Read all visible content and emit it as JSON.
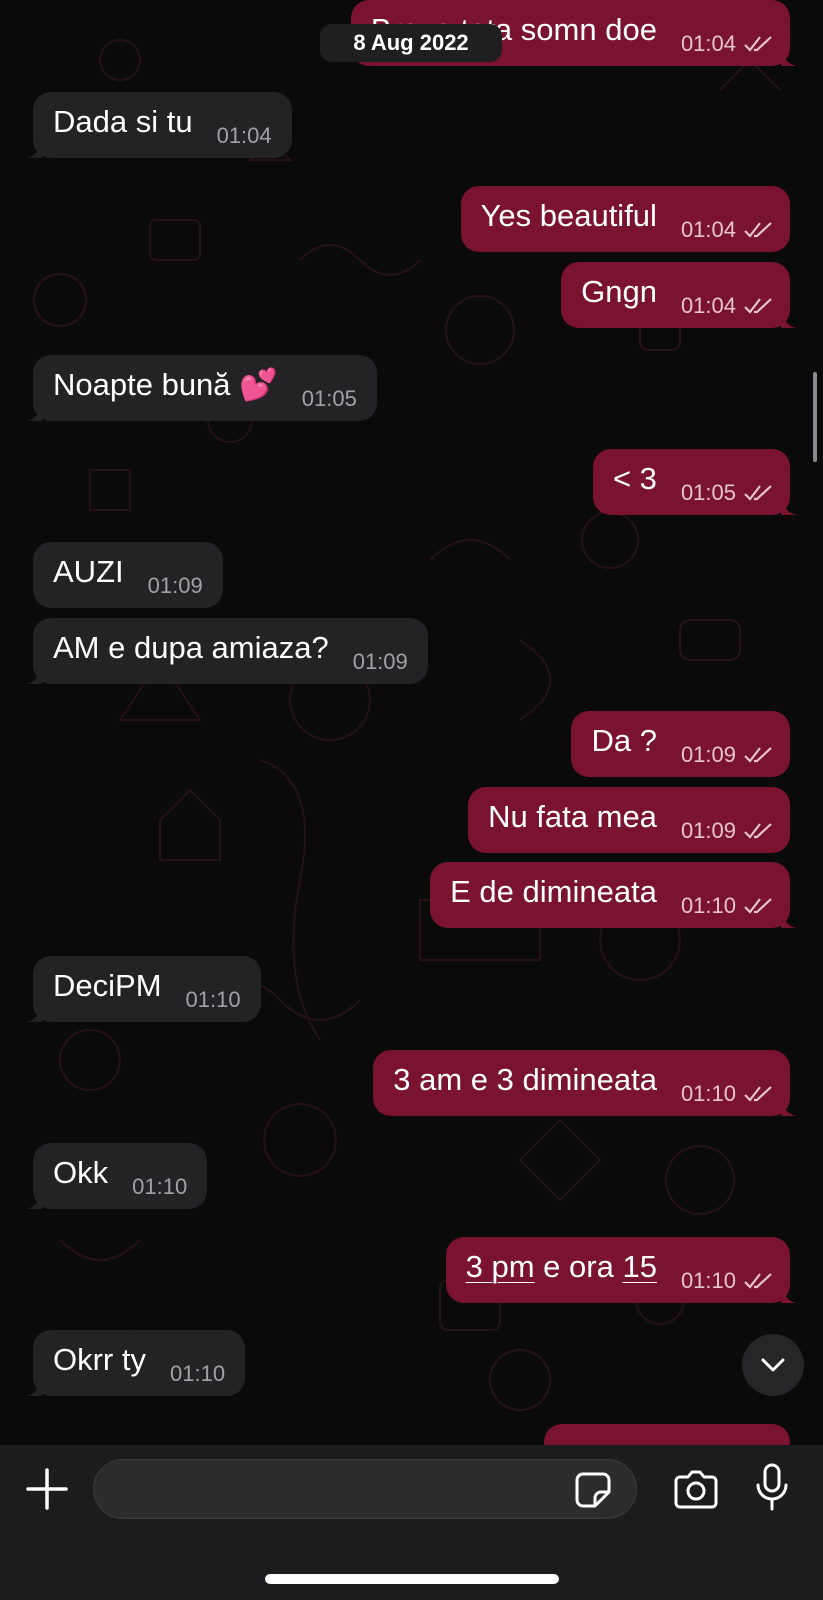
{
  "date_separator": "8 Aug 2022",
  "messages": [
    {
      "dir": "out",
      "text": "Bravo tata somn doe",
      "time": "01:04"
    },
    {
      "dir": "in",
      "text": "Dada si tu",
      "time": "01:04"
    },
    {
      "dir": "out",
      "text": "Yes beautiful",
      "time": "01:04"
    },
    {
      "dir": "out",
      "text": "Gngn",
      "time": "01:04"
    },
    {
      "dir": "in",
      "text": "Noapte bună 💕",
      "time": "01:05"
    },
    {
      "dir": "out",
      "text": "< 3",
      "time": "01:05"
    },
    {
      "dir": "in",
      "text": "AUZI",
      "time": "01:09"
    },
    {
      "dir": "in",
      "text": "AM e dupa amiaza?",
      "time": "01:09"
    },
    {
      "dir": "out",
      "text": "Da ?",
      "time": "01:09"
    },
    {
      "dir": "out",
      "text": "Nu fata mea",
      "time": "01:09"
    },
    {
      "dir": "out",
      "text": "E de dimineata",
      "time": "01:10"
    },
    {
      "dir": "in",
      "text": "DeciPM",
      "time": "01:10"
    },
    {
      "dir": "out",
      "text": "3 am e 3 dimineata",
      "time": "01:10"
    },
    {
      "dir": "in",
      "text": "Okk",
      "time": "01:10"
    },
    {
      "dir": "out",
      "text_parts": [
        "3 pm",
        " e ora ",
        "15"
      ],
      "time": "01:10"
    },
    {
      "dir": "in",
      "text": "Okrr ty",
      "time": "01:10"
    }
  ],
  "input": {
    "placeholder": "",
    "value": ""
  },
  "icons": {
    "plus": "plus-icon",
    "sticker": "sticker-icon",
    "camera": "camera-icon",
    "mic": "microphone-icon",
    "scroll_down": "chevron-down-icon",
    "read_receipt": "double-check-icon"
  },
  "colors": {
    "incoming_bubble": "#232325",
    "outgoing_bubble": "#7a1330",
    "background": "#0a0a0a",
    "input_bar": "#1c1c1e"
  }
}
